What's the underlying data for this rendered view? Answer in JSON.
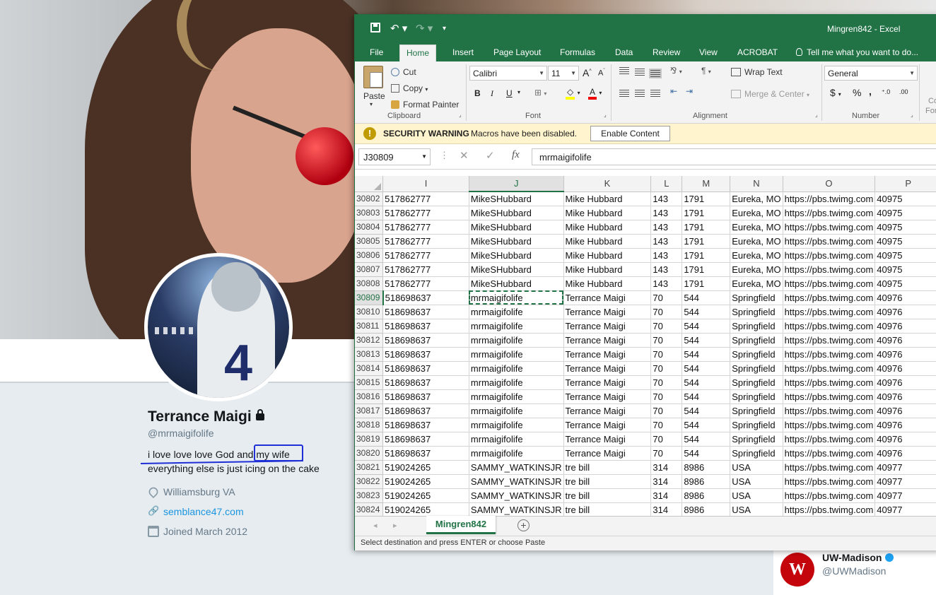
{
  "profile": {
    "name": "Terrance Maigi",
    "handle": "@mrmaigifolife",
    "bio_line1_a": "i love love love God and ",
    "bio_line1_b": "my wife",
    "bio_line2": "everything else is just icing on the cake",
    "location": "Williamsburg VA",
    "website": "semblance47.com",
    "joined": "Joined March 2012",
    "avatar_number": "4"
  },
  "suggestion": {
    "name": "UW-Madison",
    "handle": "@UWMadison",
    "logo_letter": "W"
  },
  "excel": {
    "window_title": "Mingren842 - Excel",
    "tabs": [
      "File",
      "Home",
      "Insert",
      "Page Layout",
      "Formulas",
      "Data",
      "Review",
      "View",
      "ACROBAT"
    ],
    "tell_me": "Tell me what you want to do...",
    "clipboard": {
      "paste": "Paste",
      "cut": "Cut",
      "copy": "Copy",
      "format_painter": "Format Painter",
      "label": "Clipboard"
    },
    "font": {
      "name": "Calibri",
      "size": "11",
      "label": "Font",
      "bold": "B",
      "italic": "I",
      "underline": "U",
      "grow": "A",
      "shrink": "A",
      "color_letter": "A"
    },
    "alignment": {
      "wrap_text": "Wrap Text",
      "merge_center": "Merge & Center",
      "label": "Alignment"
    },
    "number": {
      "format": "General",
      "label": "Number",
      "currency": "$",
      "percent": "%",
      "comma": ",",
      "inc_decimal": "⁺.0",
      "dec_decimal": ".00"
    },
    "styles_partial": [
      "Co",
      "For"
    ],
    "security": {
      "title": "SECURITY WARNING",
      "message": "Macros have been disabled.",
      "button": "Enable Content"
    },
    "name_box": "J30809",
    "formula": "mrmaigifolife",
    "columns": [
      "I",
      "J",
      "K",
      "L",
      "M",
      "N",
      "O",
      "P"
    ],
    "selected_column": "J",
    "selected_row": "30809",
    "rows": [
      [
        "30802",
        "517862777",
        "MikeSHubbard",
        "Mike Hubbard",
        "143",
        "1791",
        "Eureka, MO",
        "https://pbs.twimg.com",
        "40975"
      ],
      [
        "30803",
        "517862777",
        "MikeSHubbard",
        "Mike Hubbard",
        "143",
        "1791",
        "Eureka, MO",
        "https://pbs.twimg.com",
        "40975"
      ],
      [
        "30804",
        "517862777",
        "MikeSHubbard",
        "Mike Hubbard",
        "143",
        "1791",
        "Eureka, MO",
        "https://pbs.twimg.com",
        "40975"
      ],
      [
        "30805",
        "517862777",
        "MikeSHubbard",
        "Mike Hubbard",
        "143",
        "1791",
        "Eureka, MO",
        "https://pbs.twimg.com",
        "40975"
      ],
      [
        "30806",
        "517862777",
        "MikeSHubbard",
        "Mike Hubbard",
        "143",
        "1791",
        "Eureka, MO",
        "https://pbs.twimg.com",
        "40975"
      ],
      [
        "30807",
        "517862777",
        "MikeSHubbard",
        "Mike Hubbard",
        "143",
        "1791",
        "Eureka, MO",
        "https://pbs.twimg.com",
        "40975"
      ],
      [
        "30808",
        "517862777",
        "MikeSHubbard",
        "Mike Hubbard",
        "143",
        "1791",
        "Eureka, MO",
        "https://pbs.twimg.com",
        "40975"
      ],
      [
        "30809",
        "518698637",
        "mrmaigifolife",
        "Terrance Maigi",
        "70",
        "544",
        "Springfield",
        "https://pbs.twimg.com",
        "40976"
      ],
      [
        "30810",
        "518698637",
        "mrmaigifolife",
        "Terrance Maigi",
        "70",
        "544",
        "Springfield",
        "https://pbs.twimg.com",
        "40976"
      ],
      [
        "30811",
        "518698637",
        "mrmaigifolife",
        "Terrance Maigi",
        "70",
        "544",
        "Springfield",
        "https://pbs.twimg.com",
        "40976"
      ],
      [
        "30812",
        "518698637",
        "mrmaigifolife",
        "Terrance Maigi",
        "70",
        "544",
        "Springfield",
        "https://pbs.twimg.com",
        "40976"
      ],
      [
        "30813",
        "518698637",
        "mrmaigifolife",
        "Terrance Maigi",
        "70",
        "544",
        "Springfield",
        "https://pbs.twimg.com",
        "40976"
      ],
      [
        "30814",
        "518698637",
        "mrmaigifolife",
        "Terrance Maigi",
        "70",
        "544",
        "Springfield",
        "https://pbs.twimg.com",
        "40976"
      ],
      [
        "30815",
        "518698637",
        "mrmaigifolife",
        "Terrance Maigi",
        "70",
        "544",
        "Springfield",
        "https://pbs.twimg.com",
        "40976"
      ],
      [
        "30816",
        "518698637",
        "mrmaigifolife",
        "Terrance Maigi",
        "70",
        "544",
        "Springfield",
        "https://pbs.twimg.com",
        "40976"
      ],
      [
        "30817",
        "518698637",
        "mrmaigifolife",
        "Terrance Maigi",
        "70",
        "544",
        "Springfield",
        "https://pbs.twimg.com",
        "40976"
      ],
      [
        "30818",
        "518698637",
        "mrmaigifolife",
        "Terrance Maigi",
        "70",
        "544",
        "Springfield",
        "https://pbs.twimg.com",
        "40976"
      ],
      [
        "30819",
        "518698637",
        "mrmaigifolife",
        "Terrance Maigi",
        "70",
        "544",
        "Springfield",
        "https://pbs.twimg.com",
        "40976"
      ],
      [
        "30820",
        "518698637",
        "mrmaigifolife",
        "Terrance Maigi",
        "70",
        "544",
        "Springfield",
        "https://pbs.twimg.com",
        "40976"
      ],
      [
        "30821",
        "519024265",
        "SAMMY_WATKINSJR",
        "tre bill",
        "314",
        "8986",
        "USA",
        "https://pbs.twimg.com",
        "40977"
      ],
      [
        "30822",
        "519024265",
        "SAMMY_WATKINSJR",
        "tre bill",
        "314",
        "8986",
        "USA",
        "https://pbs.twimg.com",
        "40977"
      ],
      [
        "30823",
        "519024265",
        "SAMMY_WATKINSJR",
        "tre bill",
        "314",
        "8986",
        "USA",
        "https://pbs.twimg.com",
        "40977"
      ],
      [
        "30824",
        "519024265",
        "SAMMY_WATKINSJR",
        "tre bill",
        "314",
        "8986",
        "USA",
        "https://pbs.twimg.com",
        "40977"
      ]
    ],
    "sheet_tab": "Mingren842",
    "status": "Select destination and press ENTER or choose Paste"
  },
  "colors": {
    "excel_green": "#217346",
    "twitter_blue": "#1b95e0",
    "annotation_blue": "#1f2fd6",
    "security_yellow": "#fff4ce"
  }
}
